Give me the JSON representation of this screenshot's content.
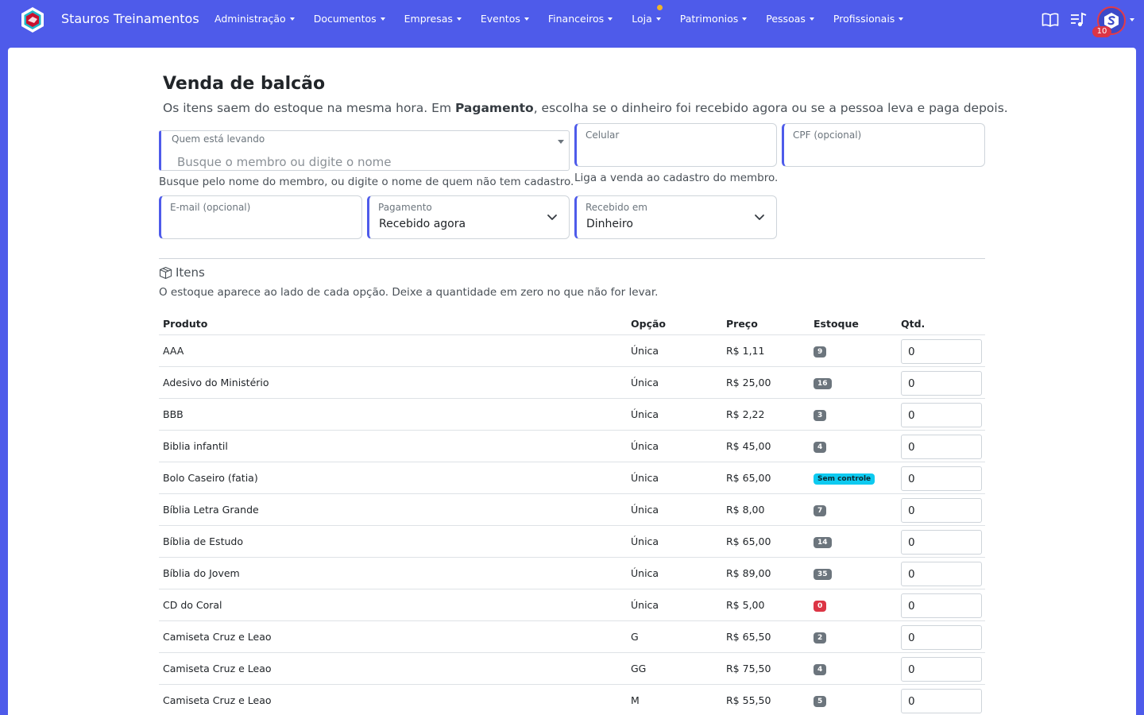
{
  "app": {
    "name": "Stauros Treinamentos"
  },
  "nav": {
    "items": [
      {
        "label": "Administração"
      },
      {
        "label": "Documentos"
      },
      {
        "label": "Empresas"
      },
      {
        "label": "Eventos"
      },
      {
        "label": "Financeiros"
      },
      {
        "label": "Loja"
      },
      {
        "label": "Patrimonios"
      },
      {
        "label": "Pessoas"
      },
      {
        "label": "Profissionais"
      }
    ],
    "notification_count": "10"
  },
  "page": {
    "title": "Venda de balcão",
    "subtitle_pre": "Os itens saem do estoque na mesma hora. Em ",
    "subtitle_bold": "Pagamento",
    "subtitle_post": ", escolha se o dinheiro foi recebido agora ou se a pessoa leva e paga depois."
  },
  "form": {
    "buyer": {
      "label": "Quem está levando",
      "placeholder": "Busque o membro ou digite o nome",
      "help": "Busque pelo nome do membro, ou digite o nome de quem não tem cadastro."
    },
    "phone": {
      "label": "Celular",
      "value": "",
      "help": "Liga a venda ao cadastro do membro."
    },
    "cpf": {
      "label": "CPF (opcional)",
      "value": ""
    },
    "email": {
      "label": "E-mail (opcional)",
      "value": ""
    },
    "payment": {
      "label": "Pagamento",
      "value": "Recebido agora"
    },
    "received_in": {
      "label": "Recebido em",
      "value": "Dinheiro"
    }
  },
  "items_section": {
    "title": "Itens",
    "help": "O estoque aparece ao lado de cada opção. Deixe a quantidade em zero no que não for levar.",
    "columns": {
      "product": "Produto",
      "option": "Opção",
      "price": "Preço",
      "stock": "Estoque",
      "qty": "Qtd."
    },
    "colors": {
      "stock_default": "#6c757d",
      "stock_uncontrolled": "#0dcaf0",
      "stock_zero": "#dc3545"
    },
    "rows": [
      {
        "product": "AAA",
        "option": "Única",
        "price": "R$ 1,11",
        "stock": "9",
        "stock_type": "default",
        "qty": "0"
      },
      {
        "product": "Adesivo do Ministério",
        "option": "Única",
        "price": "R$ 25,00",
        "stock": "16",
        "stock_type": "default",
        "qty": "0"
      },
      {
        "product": "BBB",
        "option": "Única",
        "price": "R$ 2,22",
        "stock": "3",
        "stock_type": "default",
        "qty": "0"
      },
      {
        "product": "Biblia infantil",
        "option": "Única",
        "price": "R$ 45,00",
        "stock": "4",
        "stock_type": "default",
        "qty": "0"
      },
      {
        "product": "Bolo Caseiro (fatia)",
        "option": "Única",
        "price": "R$ 65,00",
        "stock": "Sem controle",
        "stock_type": "uncontrolled",
        "qty": "0"
      },
      {
        "product": "Bíblia Letra Grande",
        "option": "Única",
        "price": "R$ 8,00",
        "stock": "7",
        "stock_type": "default",
        "qty": "0"
      },
      {
        "product": "Bíblia de Estudo",
        "option": "Única",
        "price": "R$ 65,00",
        "stock": "14",
        "stock_type": "default",
        "qty": "0"
      },
      {
        "product": "Bíblia do Jovem",
        "option": "Única",
        "price": "R$ 89,00",
        "stock": "35",
        "stock_type": "default",
        "qty": "0"
      },
      {
        "product": "CD do Coral",
        "option": "Única",
        "price": "R$ 5,00",
        "stock": "0",
        "stock_type": "zero",
        "qty": "0"
      },
      {
        "product": "Camiseta Cruz e Leao",
        "option": "G",
        "price": "R$ 65,50",
        "stock": "2",
        "stock_type": "default",
        "qty": "0"
      },
      {
        "product": "Camiseta Cruz e Leao",
        "option": "GG",
        "price": "R$ 75,50",
        "stock": "4",
        "stock_type": "default",
        "qty": "0"
      },
      {
        "product": "Camiseta Cruz e Leao",
        "option": "M",
        "price": "R$ 55,50",
        "stock": "5",
        "stock_type": "default",
        "qty": "0"
      }
    ]
  }
}
